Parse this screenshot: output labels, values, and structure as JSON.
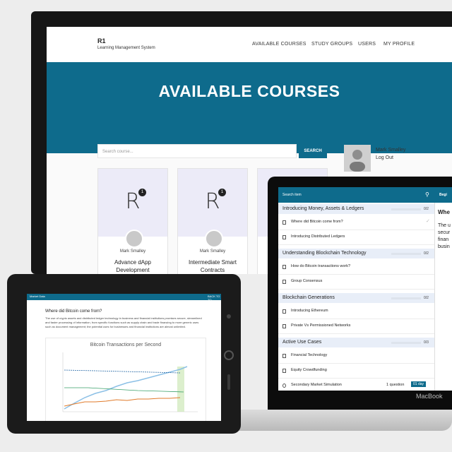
{
  "desktop": {
    "brand": {
      "title": "R1",
      "subtitle": "Learning Management System"
    },
    "nav": [
      "AVAILABLE COURSES",
      "STUDY GROUPS",
      "USERS",
      "MY PROFILE"
    ],
    "hero_title": "AVAILABLE COURSES",
    "search": {
      "placeholder": "Search course...",
      "button": "SEARCH"
    },
    "profile": {
      "name": "Mark Smalley",
      "logout": "Log Out"
    },
    "courses": [
      {
        "logo": "R",
        "badge": "1",
        "author": "Mark Smalley",
        "title_line1": "Advance dApp",
        "title_line2": "Development"
      },
      {
        "logo": "R",
        "badge": "1",
        "author": "Mark Smalley",
        "title_line1": "Intermediate Smart",
        "title_line2": "Contracts"
      },
      {
        "logo": "R",
        "badge": "1",
        "author": "",
        "title_line1": "",
        "title_line2": ""
      }
    ]
  },
  "laptop": {
    "search_placeholder": "Search item",
    "begin_label": "Begi",
    "right_title": "Whe",
    "right_lines": [
      "The u",
      "secur",
      "finan",
      "busin"
    ],
    "sections": [
      {
        "title": "Introducing Money, Assets & Ledgers",
        "count": "0/2",
        "items": [
          {
            "label": "Where did Bitcoin come from?",
            "status": "✓"
          },
          {
            "label": "Introducing Distributed Ledgers"
          }
        ]
      },
      {
        "title": "Understanding Blockchain Technology",
        "count": "0/2",
        "items": [
          {
            "label": "How do Bitcoin transactions work?"
          },
          {
            "label": "Group Consensus"
          }
        ]
      },
      {
        "title": "Blockchain Generations",
        "count": "0/2",
        "items": [
          {
            "label": "Introducing Ethereum"
          },
          {
            "label": "Private Vs Permissioned Networks"
          }
        ]
      },
      {
        "title": "Active Use Cases",
        "count": "0/3",
        "items": [
          {
            "label": "Financial Technology"
          },
          {
            "label": "Equity Crowdfunding"
          },
          {
            "label": "Secondary Market Simulation",
            "meta": "1 question",
            "tag": "01 day"
          }
        ]
      }
    ],
    "brand": "MacBook"
  },
  "tablet": {
    "bar_left": "Market Data",
    "bar_right": "BACK TO TO",
    "question": "Where did Bitcoin come from?",
    "paragraph": "The use of crypto assets and distributed ledger technology in business and financial institutions promises secure, streamlined and faster processing of information, from specific functions such as supply chain and trade financing to more generic uses such as document management; the potential uses for businesses and financial institutions are almost unlimited.",
    "chart_title": "Bitcoin Transactions per Second"
  },
  "colors": {
    "accent": "#0e6b8c",
    "section_bg": "#e8eef8",
    "card_top": "#ecebf8"
  },
  "icons": [
    "search-icon",
    "document-icon",
    "check-icon",
    "avatar-icon",
    "camera-icon",
    "home-button-icon"
  ]
}
